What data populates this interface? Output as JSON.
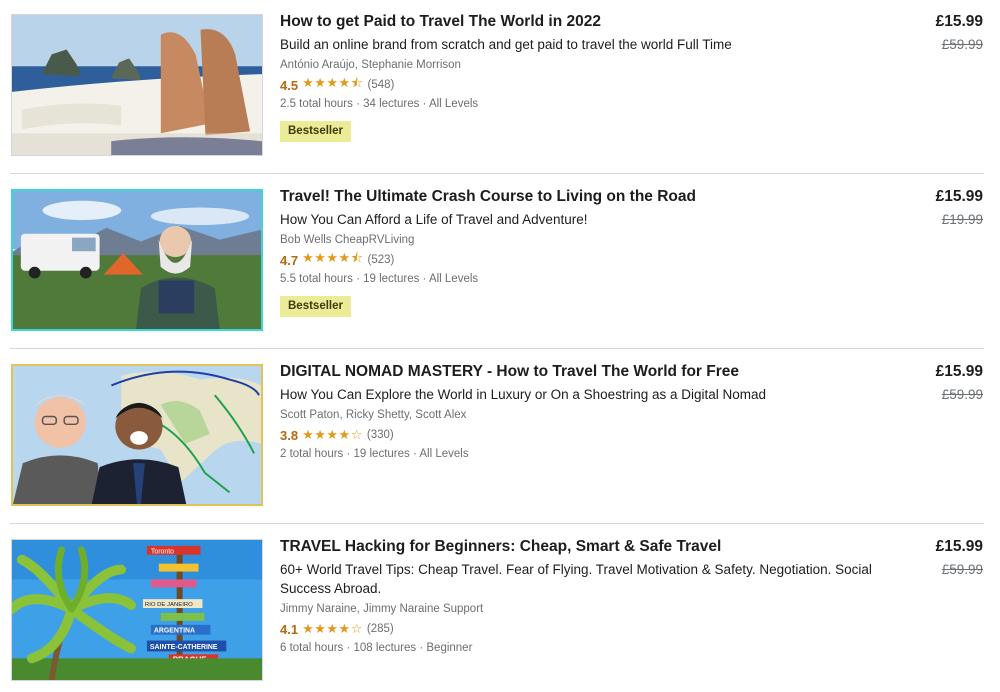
{
  "courses": [
    {
      "title": "How to get Paid to Travel The World in 2022",
      "headline": "Build an online brand from scratch and get paid to travel the world Full Time",
      "instructors": "António Araújo, Stephanie Morrison",
      "rating": "4.5",
      "rating_stars": 4.5,
      "stars_display": "★★★★⯪",
      "rating_count": "(548)",
      "meta": "2.5 total hours · 34 lectures · All Levels",
      "badge": "Bestseller",
      "price": "£15.99",
      "original_price": "£59.99"
    },
    {
      "title": "Travel! The Ultimate Crash Course to Living on the Road",
      "headline": "How You Can Afford a Life of Travel and Adventure!",
      "instructors": "Bob Wells CheapRVLiving",
      "rating": "4.7",
      "rating_stars": 4.5,
      "stars_display": "★★★★⯪",
      "rating_count": "(523)",
      "meta": "5.5 total hours · 19 lectures · All Levels",
      "badge": "Bestseller",
      "price": "£15.99",
      "original_price": "£19.99"
    },
    {
      "title": "DIGITAL NOMAD MASTERY - How to Travel The World for Free",
      "headline": "How You Can Explore the World in Luxury or On a Shoestring as a Digital Nomad",
      "instructors": "Scott Paton, Ricky Shetty, Scott Alex",
      "rating": "3.8",
      "rating_stars": 4,
      "stars_display": "★★★★☆",
      "rating_count": "(330)",
      "meta": "2 total hours · 19 lectures · All Levels",
      "badge": "",
      "price": "£15.99",
      "original_price": "£59.99"
    },
    {
      "title": "TRAVEL Hacking for Beginners: Cheap, Smart & Safe Travel",
      "headline": "60+ World Travel Tips: Cheap Travel. Fear of Flying. Travel Motivation & Safety. Negotiation. Social Success Abroad.",
      "instructors": "Jimmy Naraine, Jimmy Naraine Support",
      "rating": "4.1",
      "rating_stars": 4,
      "stars_display": "★★★★☆",
      "rating_count": "(285)",
      "meta": "6 total hours · 108 lectures · Beginner",
      "badge": "",
      "price": "£15.99",
      "original_price": "£59.99"
    }
  ],
  "thumbnail_signs": [
    "Toronto",
    "RIO DE JANEIRO",
    "ARGENTINA",
    "SAINTE-CATHERINE",
    "PRAGUE"
  ],
  "colors": {
    "rating": "#b4690e",
    "star": "#e59819",
    "badge_bg": "#eceb98",
    "text": "#1c1d1f",
    "muted": "#6a6f73"
  }
}
